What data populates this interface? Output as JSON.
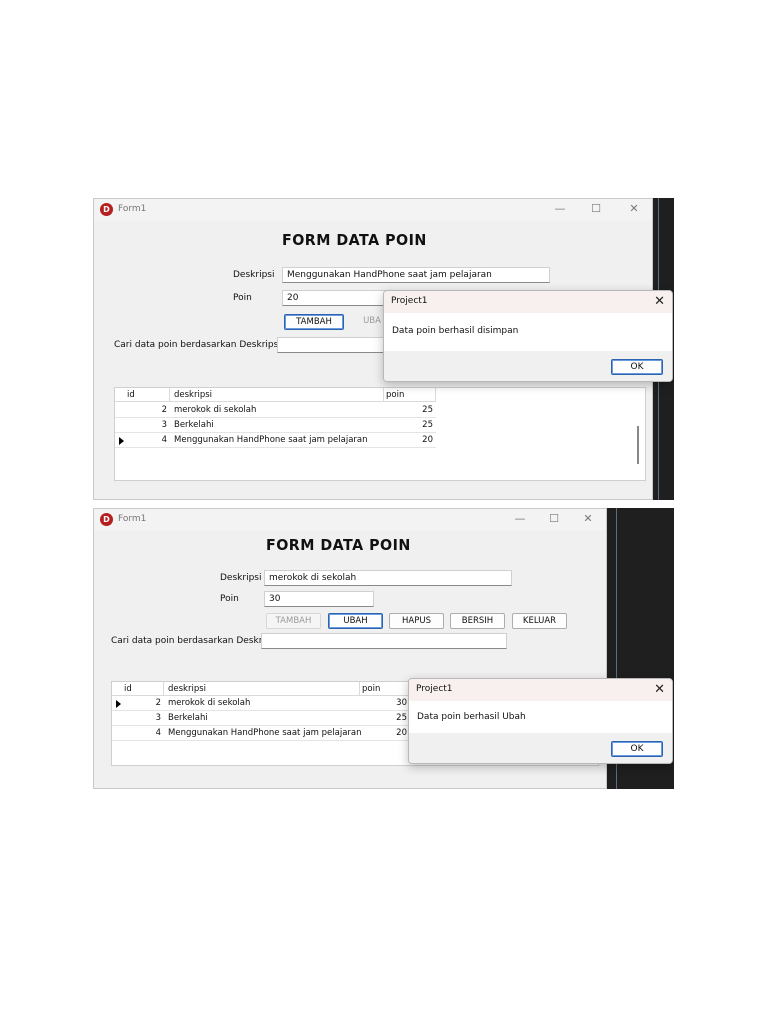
{
  "shot1": {
    "window_title": "Form1",
    "heading": "FORM DATA POIN",
    "deskripsi_label": "Deskripsi",
    "deskripsi_value": "Menggunakan HandPhone saat jam pelajaran",
    "poin_label": "Poin",
    "poin_value": "20",
    "buttons": {
      "tambah": "TAMBAH",
      "ubah_partial": "UBA"
    },
    "search_label": "Cari data poin berdasarkan Deskripsi",
    "search_value": "",
    "grid": {
      "columns": [
        "id",
        "deskripsi",
        "poin"
      ],
      "rows": [
        {
          "id": "2",
          "deskripsi": "merokok di sekolah",
          "poin": "25"
        },
        {
          "id": "3",
          "deskripsi": "Berkelahi",
          "poin": "25"
        },
        {
          "id": "4",
          "deskripsi": "Menggunakan HandPhone saat jam pelajaran",
          "poin": "20"
        }
      ],
      "selected_row": 2
    },
    "dialog": {
      "title": "Project1",
      "message": "Data poin berhasil disimpan",
      "ok": "OK"
    }
  },
  "shot2": {
    "window_title": "Form1",
    "heading": "FORM DATA POIN",
    "deskripsi_label": "Deskripsi",
    "deskripsi_value": "merokok di sekolah",
    "poin_label": "Poin",
    "poin_value": "30",
    "buttons": {
      "tambah": "TAMBAH",
      "ubah": "UBAH",
      "hapus": "HAPUS",
      "bersih": "BERSIH",
      "keluar": "KELUAR"
    },
    "search_label": "Cari data poin berdasarkan Deskripsi",
    "search_value": "",
    "grid": {
      "columns": [
        "id",
        "deskripsi",
        "poin"
      ],
      "rows": [
        {
          "id": "2",
          "deskripsi": "merokok di sekolah",
          "poin": "30"
        },
        {
          "id": "3",
          "deskripsi": "Berkelahi",
          "poin": "25"
        },
        {
          "id": "4",
          "deskripsi": "Menggunakan HandPhone saat jam pelajaran",
          "poin": "20"
        }
      ],
      "selected_row": 0
    },
    "dialog": {
      "title": "Project1",
      "message": "Data poin berhasil Ubah",
      "ok": "OK"
    }
  },
  "icons": {
    "app": "delphi-app-icon",
    "minimize": "minimize-icon",
    "maximize": "maximize-icon",
    "close": "close-icon"
  },
  "colors": {
    "window_bg": "#f0f0f0",
    "dialog_title_bg": "#f7f0ef",
    "dark_bg": "#1f1f1f",
    "ok_border": "#2f63b0"
  }
}
